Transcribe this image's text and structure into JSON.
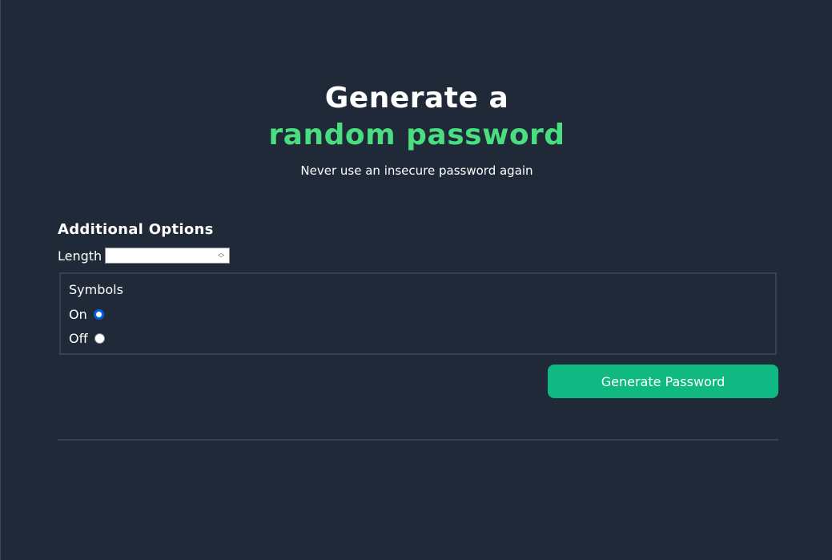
{
  "hero": {
    "title_line1": "Generate a",
    "title_line2": "random password",
    "subtitle": "Never use an insecure password again"
  },
  "options": {
    "heading": "Additional Options",
    "length_label": "Length",
    "length_value": "",
    "symbols": {
      "legend": "Symbols",
      "choices": [
        {
          "label": "On",
          "checked": true
        },
        {
          "label": "Off",
          "checked": false
        }
      ]
    }
  },
  "actions": {
    "generate_label": "Generate Password"
  },
  "colors": {
    "background": "#1f2937",
    "accent_green": "#4ade80",
    "button_green": "#10b981",
    "radio_selected": "#0060df"
  },
  "icons": {
    "spinner": "number-spinner-icon"
  }
}
